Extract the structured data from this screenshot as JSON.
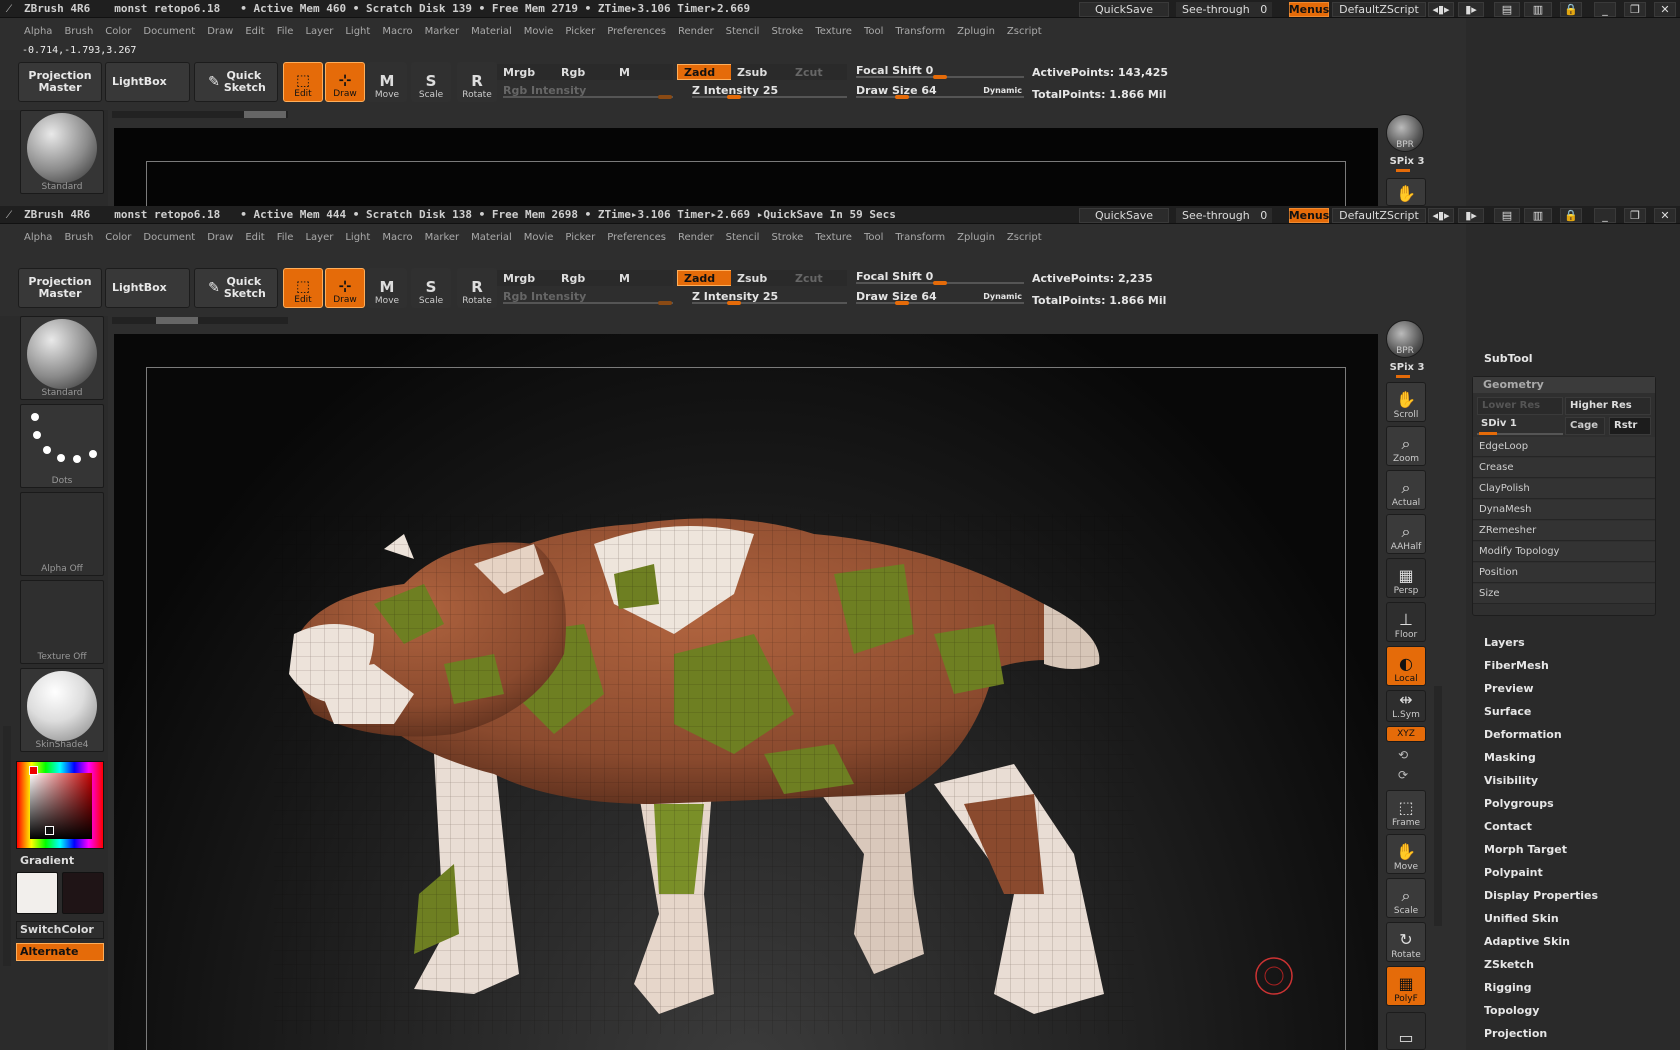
{
  "app": {
    "name": "ZBrush 4R6"
  },
  "windows": [
    {
      "doc": "monst retopo6.18",
      "status": "• Active Mem 460 • Scratch Disk 139 • Free Mem 2719 • ZTime▸3.106 Timer▸2.669",
      "active_points": "ActivePoints: 143,425",
      "total_points": "TotalPoints: 1.866 Mil"
    },
    {
      "doc": "monst retopo6.18",
      "status": "• Active Mem 444 • Scratch Disk 138 • Free Mem 2698 • ZTime▸3.106 Timer▸2.669 ▸QuickSave In 59 Secs",
      "active_points": "ActivePoints: 2,235",
      "total_points": "TotalPoints: 1.866 Mil"
    }
  ],
  "titlebar": {
    "quicksave": "QuickSave",
    "seethrough": "See-through",
    "seethrough_value": "0",
    "menus": "Menus",
    "script": "DefaultZScript"
  },
  "menu_items": [
    "Alpha",
    "Brush",
    "Color",
    "Document",
    "Draw",
    "Edit",
    "File",
    "Layer",
    "Light",
    "Macro",
    "Marker",
    "Material",
    "Movie",
    "Picker",
    "Preferences",
    "Render",
    "Stencil",
    "Stroke",
    "Texture",
    "Tool",
    "Transform",
    "Zplugin",
    "Zscript"
  ],
  "coords": "-0.714,-1.793,3.267",
  "toolbar": {
    "projection_master": "Projection Master",
    "lightbox": "LightBox",
    "quick_sketch": "Quick Sketch",
    "edit": "Edit",
    "draw": "Draw",
    "move": "Move",
    "scale": "Scale",
    "rotate": "Rotate",
    "mrgb": "Mrgb",
    "rgb": "Rgb",
    "m": "M",
    "zadd": "Zadd",
    "zsub": "Zsub",
    "zcut": "Zcut",
    "rgb_intensity": "Rgb Intensity",
    "z_intensity": "Z Intensity 25",
    "focal_shift": "Focal Shift 0",
    "draw_size": "Draw Size 64",
    "dynamic": "Dynamic",
    "z_intensity_level": 0.25,
    "draw_size_level": 0.25,
    "focal_shift_level": 0.5
  },
  "left_shelf": {
    "brush": "Standard",
    "stroke": "Dots",
    "alpha": "Alpha Off",
    "texture": "Texture Off",
    "material": "SkinShade4",
    "gradient": "Gradient",
    "switchcolor": "SwitchColor",
    "alternate": "Alternate",
    "main_color": "#f2efec",
    "secondary_color": "#1f1416"
  },
  "right_shelf": {
    "bpr": "BPR",
    "spix": "SPix 3",
    "scroll": "Scroll",
    "zoom": "Zoom",
    "actual": "Actual",
    "aahalf": "AAHalf",
    "persp": "Persp",
    "floor": "Floor",
    "local": "Local",
    "lsym": "L.Sym",
    "xyz": "XYZ",
    "frame": "Frame",
    "move": "Move",
    "scale": "Scale",
    "rotate": "Rotate",
    "polyf": "PolyF"
  },
  "tool_thumbs_top": [
    "PM3D_Sphere3D3_",
    "PM3D_Sphere3D3_",
    "PM3D_Sphere3D3_",
    "PM3D_Sphere3D3_",
    "PM3D_Sphere3D4",
    "PM3D_Sphere3D3",
    "PM3D_Sphere3D3_",
    "ZSphere"
  ],
  "tool_thumbs_bottom": [
    "PM3D_Sphere3D3_",
    "PM3D_Sphere3D3_",
    "PM3D_Sphere3D4",
    "PM3D_Sphere3D3",
    "PM3D_Sphere3D3_",
    "ZSphere"
  ],
  "zsphere_count": "7",
  "subtool": "SubTool",
  "geometry": {
    "title": "Geometry",
    "lower_res": "Lower Res",
    "higher_res": "Higher Res",
    "sdiv": "SDiv 1",
    "cage": "Cage",
    "rstr": "Rstr",
    "items": [
      "EdgeLoop",
      "Crease",
      "ClayPolish",
      "DynaMesh",
      "ZRemesher",
      "Modify Topology",
      "Position",
      "Size"
    ]
  },
  "tool_palettes": [
    "Layers",
    "FiberMesh",
    "Preview",
    "Surface",
    "Deformation",
    "Masking",
    "Visibility",
    "Polygroups",
    "Contact",
    "Morph Target",
    "Polypaint",
    "Display Properties",
    "Unified Skin",
    "Adaptive Skin",
    "ZSketch",
    "Rigging",
    "Topology",
    "Projection"
  ],
  "colors": {
    "accent": "#e56b09",
    "bg": "#2e2e2e",
    "viewport": "#050505"
  }
}
